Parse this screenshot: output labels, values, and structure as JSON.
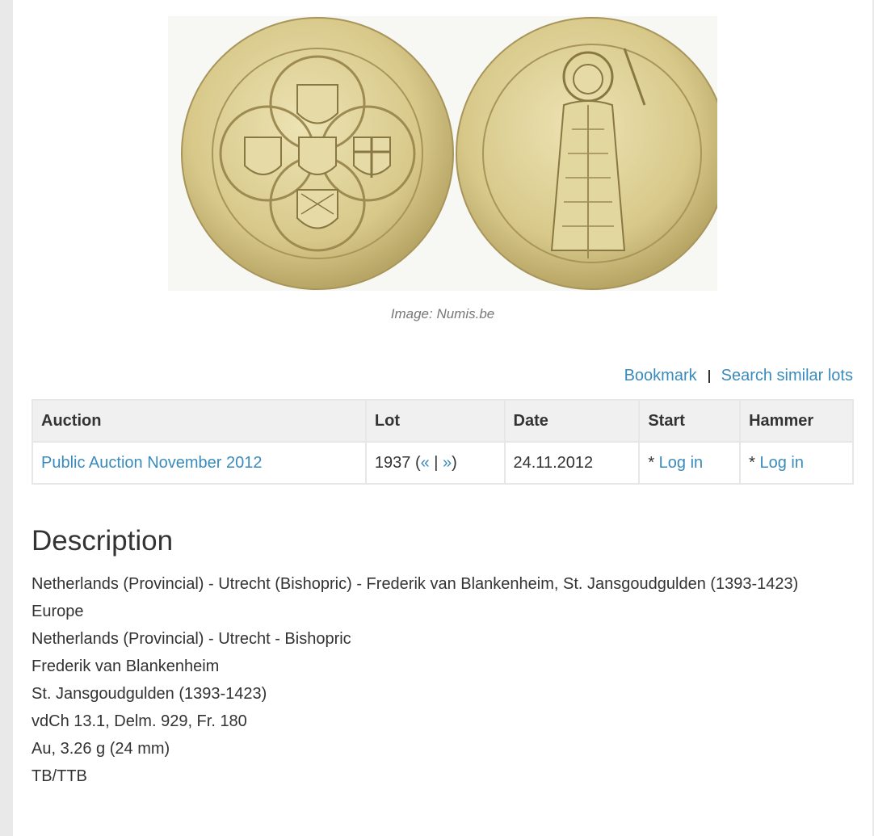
{
  "image": {
    "caption": "Image: Numis.be"
  },
  "actions": {
    "bookmark": "Bookmark",
    "search_similar": "Search similar lots"
  },
  "table": {
    "headers": [
      "Auction",
      "Lot",
      "Date",
      "Start",
      "Hammer"
    ],
    "row": {
      "auction": "Public Auction November 2012",
      "lot_number": "1937",
      "lot_open": " (",
      "prev": "«",
      "lot_sep": " | ",
      "next": "»",
      "lot_close": ")",
      "date": "24.11.2012",
      "start_prefix": "* ",
      "start_link": "Log in",
      "hammer_prefix": "* ",
      "hammer_link": "Log in"
    }
  },
  "description": {
    "title": "Description",
    "lines": [
      "Netherlands (Provincial) - Utrecht (Bishopric) - Frederik van Blankenheim, St. Jansgoudgulden (1393-1423)",
      "Europe",
      "Netherlands (Provincial) - Utrecht - Bishopric",
      "Frederik van Blankenheim",
      "St. Jansgoudgulden (1393-1423)",
      "vdCh 13.1, Delm. 929, Fr. 180",
      "Au, 3.26 g (24 mm)",
      "TB/TTB"
    ]
  },
  "colors": {
    "link": "#3a8bbd",
    "text": "#333333",
    "header_bg": "#f0f0f0",
    "gold": "#d8c98a"
  }
}
